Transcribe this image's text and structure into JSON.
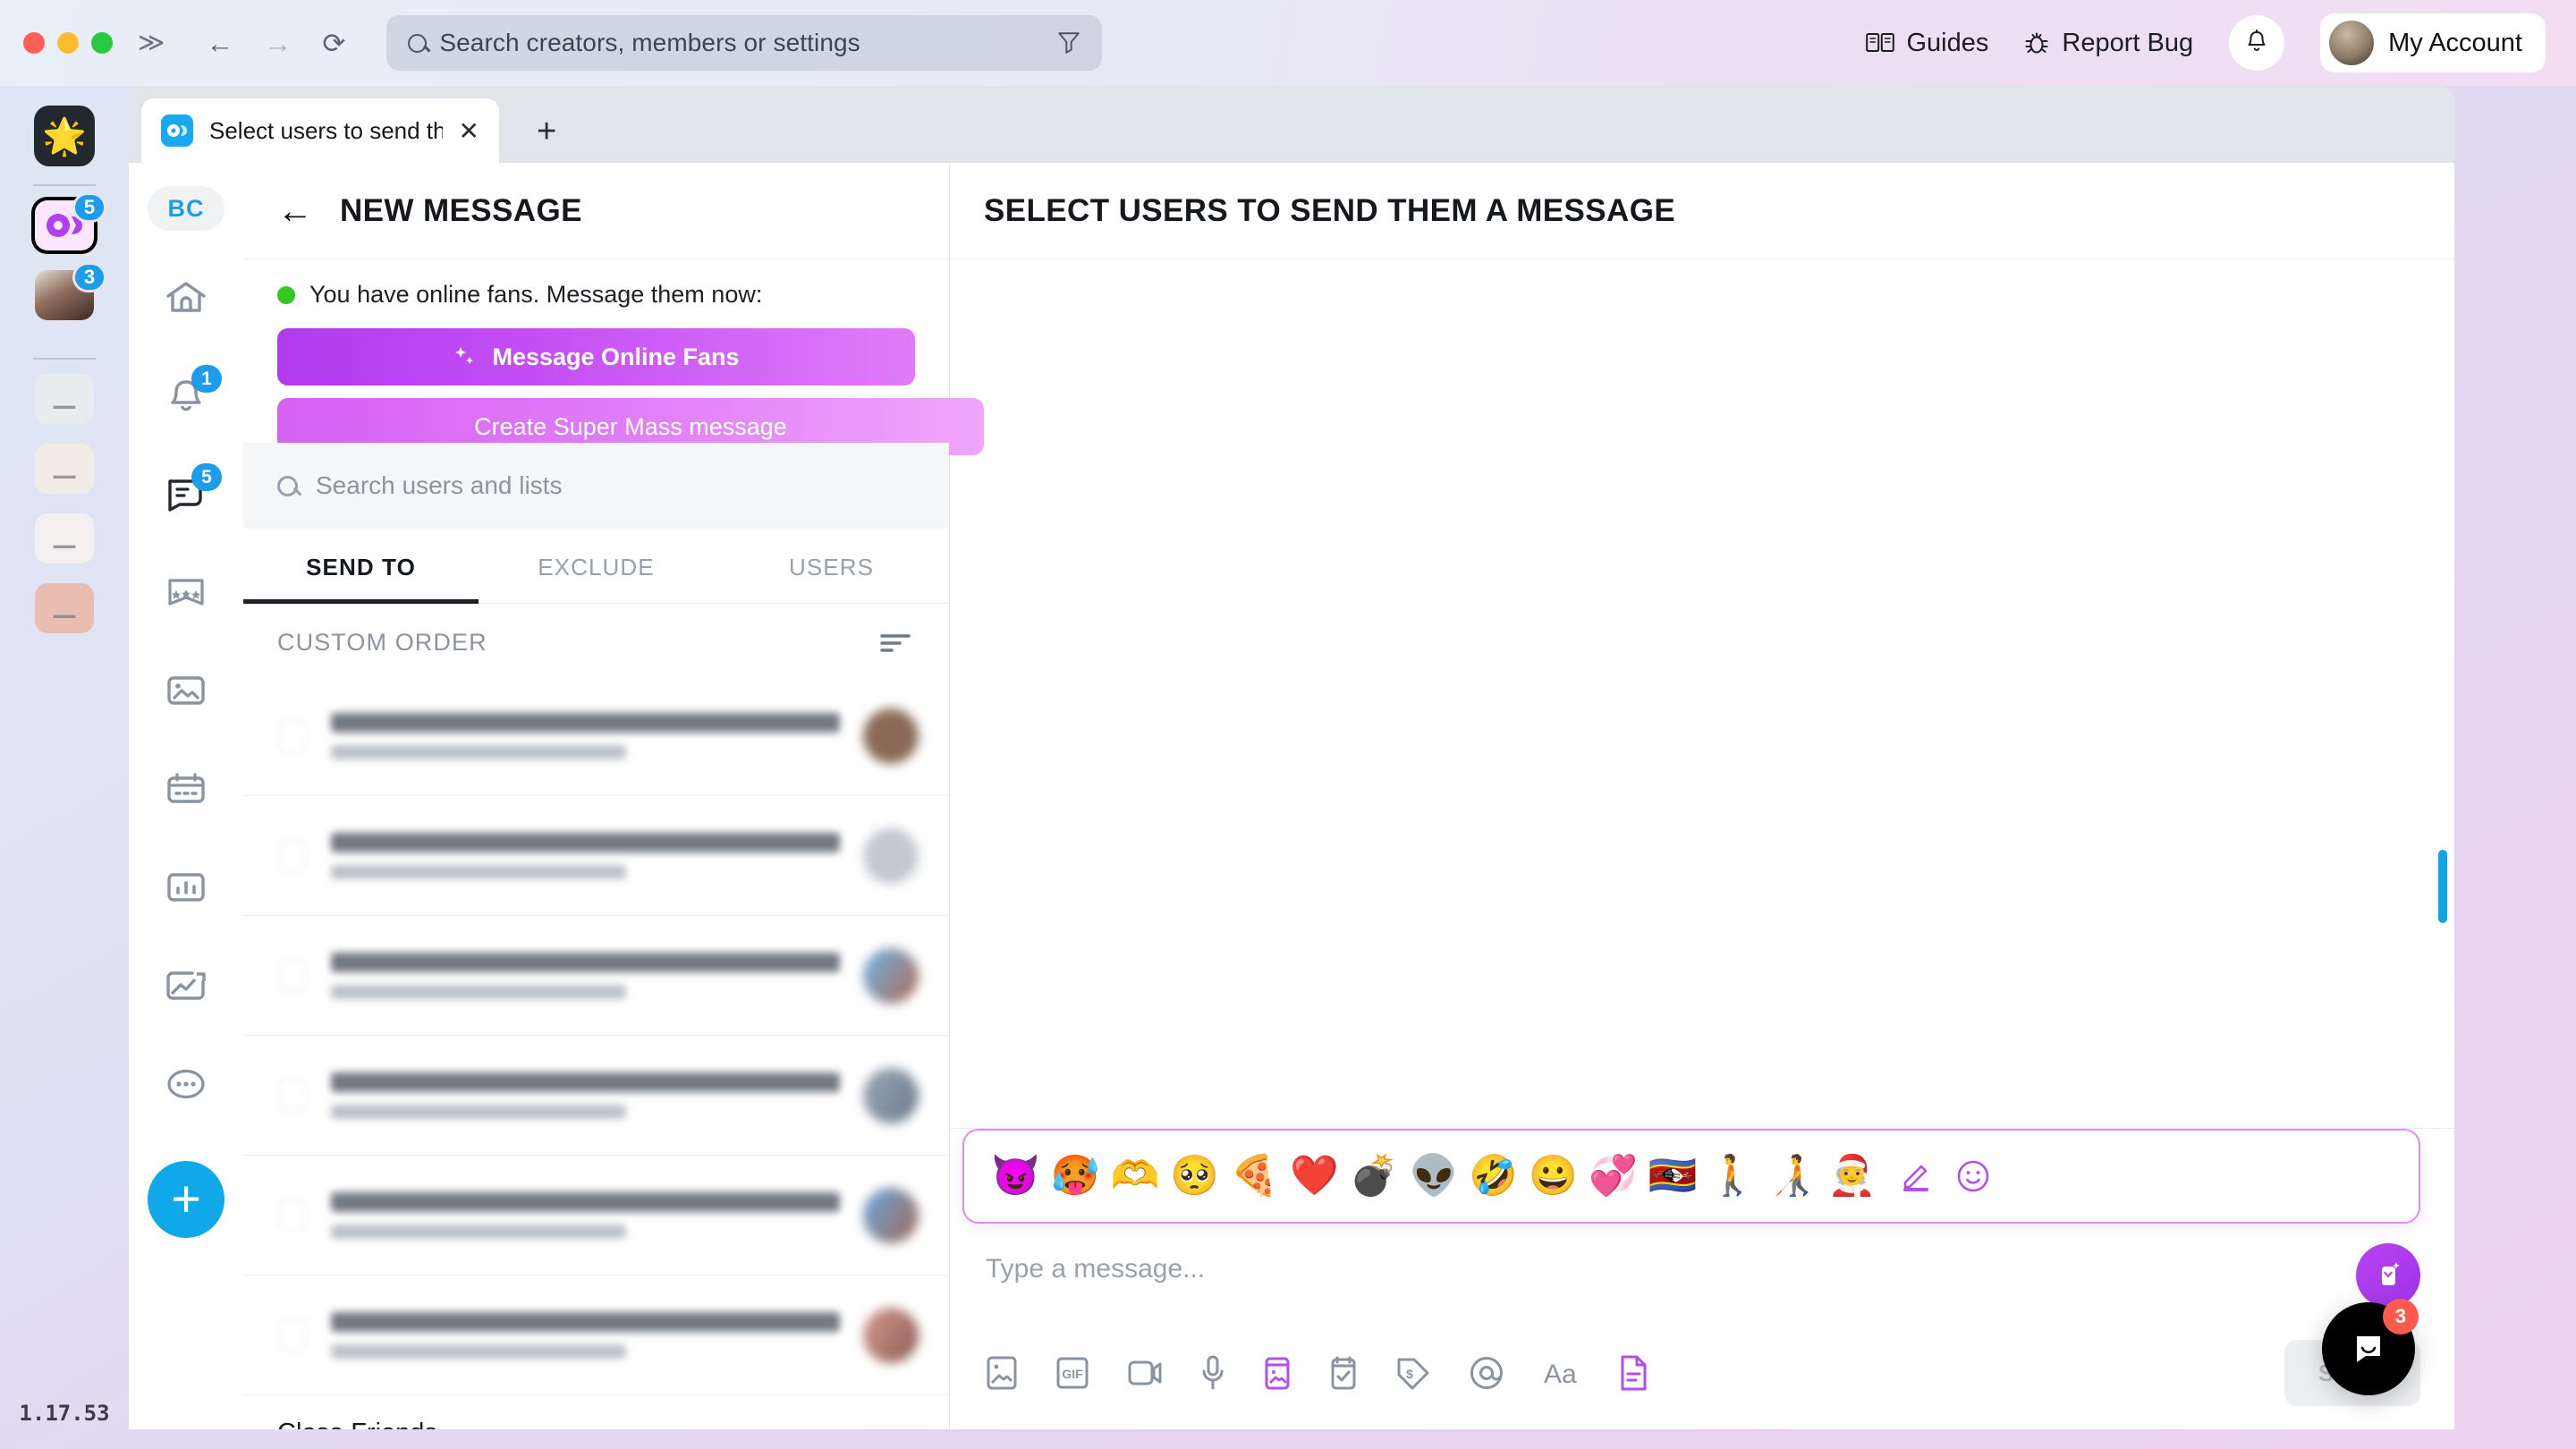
{
  "os": {
    "nav": {
      "back": "←",
      "forward": "→",
      "reload": "⟳",
      "expand": "≫"
    },
    "omnibox": {
      "placeholder": "Search creators, members or settings",
      "value": ""
    },
    "guides_label": "Guides",
    "report_bug_label": "Report Bug",
    "account_label": "My Account"
  },
  "rail": {
    "logo_glyph": "🌟",
    "items": [
      {
        "name": "creator-onlyfans",
        "badge": "5",
        "active": true
      },
      {
        "name": "creator-avatar-2",
        "badge": "3",
        "active": false
      },
      {
        "name": "creator-avatar-3",
        "badge": "",
        "active": false
      },
      {
        "name": "creator-avatar-4",
        "badge": "",
        "active": false
      },
      {
        "name": "creator-avatar-5",
        "badge": "",
        "active": false
      },
      {
        "name": "creator-avatar-6",
        "badge": "",
        "active": false
      }
    ],
    "version": "1.17.53"
  },
  "browser": {
    "tab_title": "Select users to send the...",
    "tab_close": "✕",
    "tab_new": "+"
  },
  "appnav": {
    "profile_initials": "BC",
    "items": [
      {
        "name": "home",
        "badge": ""
      },
      {
        "name": "notifications",
        "badge": "1"
      },
      {
        "name": "messages",
        "badge": "5"
      },
      {
        "name": "queue",
        "badge": ""
      },
      {
        "name": "media-vault",
        "badge": ""
      },
      {
        "name": "calendar",
        "badge": ""
      },
      {
        "name": "statistics",
        "badge": ""
      },
      {
        "name": "trends",
        "badge": ""
      },
      {
        "name": "more",
        "badge": ""
      }
    ],
    "fab_label": "+"
  },
  "panel": {
    "back_arrow": "←",
    "title": "NEW MESSAGE",
    "online_notice": "You have online fans. Message them now:",
    "message_online_fans": "Message Online Fans",
    "create_super_mass": "Create Super Mass message",
    "search_placeholder": "Search users and lists",
    "tabs": [
      {
        "label": "SEND TO",
        "active": true
      },
      {
        "label": "EXCLUDE",
        "active": false
      },
      {
        "label": "USERS",
        "active": false
      }
    ],
    "order_label": "CUSTOM ORDER",
    "rows": [
      {
        "name": "",
        "sub": "",
        "avatar": "#8a6a56"
      },
      {
        "name": "",
        "sub": "",
        "avatar": "#b9bec6"
      },
      {
        "name": "",
        "sub": "",
        "avatar": "#5e9ad0"
      },
      {
        "name": "",
        "sub": "",
        "avatar": "#7e94b0"
      },
      {
        "name": "",
        "sub": "",
        "avatar": "#6ea3d8"
      },
      {
        "name": "",
        "sub": "",
        "avatar": "#c98b80"
      }
    ],
    "close_friends": "Close Friends"
  },
  "chat": {
    "title": "SELECT USERS TO SEND THEM A MESSAGE",
    "input_placeholder": "Type a message...",
    "send_label": "SEND",
    "emojis": [
      "😈",
      "🥵",
      "🫶",
      "🥺",
      "🍕",
      "❤️",
      "💣",
      "👽",
      "🤣",
      "😀",
      "💞",
      "🇸🇿",
      "🚶",
      "🧑‍🦯",
      "🧑‍🎄"
    ],
    "emoji_actions": [
      "edit-emoji",
      "emoji-picker"
    ],
    "tools": [
      {
        "name": "image",
        "accent": false
      },
      {
        "name": "gif",
        "accent": false
      },
      {
        "name": "video",
        "accent": false
      },
      {
        "name": "voice",
        "accent": false
      },
      {
        "name": "vault-media",
        "accent": true
      },
      {
        "name": "poll",
        "accent": false
      },
      {
        "name": "price-tag",
        "accent": false
      },
      {
        "name": "mention",
        "accent": false
      },
      {
        "name": "text-format",
        "accent": false
      },
      {
        "name": "script",
        "accent": true
      }
    ]
  },
  "intercom": {
    "badge": "3"
  },
  "colors": {
    "accent_blue": "#1b9dec",
    "accent_purple": "#b24ef0",
    "online_green": "#36c626",
    "badge_red": "#ff5a4e"
  }
}
